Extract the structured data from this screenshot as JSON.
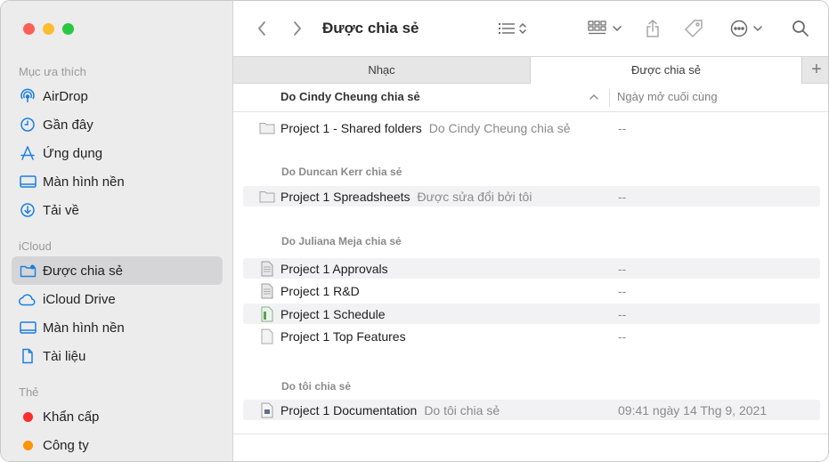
{
  "window": {
    "title": "Được chia sẻ"
  },
  "sidebar": {
    "sections": [
      {
        "heading": "Mục ưa thích",
        "items": [
          {
            "label": "AirDrop",
            "icon": "airdrop-icon"
          },
          {
            "label": "Gần đây",
            "icon": "clock-icon"
          },
          {
            "label": "Ứng dụng",
            "icon": "applications-icon"
          },
          {
            "label": "Màn hình nền",
            "icon": "desktop-icon"
          },
          {
            "label": "Tải về",
            "icon": "download-icon"
          }
        ]
      },
      {
        "heading": "iCloud",
        "items": [
          {
            "label": "Được chia sẻ",
            "icon": "shared-folder-icon",
            "active": true
          },
          {
            "label": "iCloud Drive",
            "icon": "cloud-icon"
          },
          {
            "label": "Màn hình nền",
            "icon": "desktop-icon"
          },
          {
            "label": "Tài liệu",
            "icon": "document-icon"
          }
        ]
      },
      {
        "heading": "Thẻ",
        "items": [
          {
            "label": "Khẩn cấp",
            "color": "#ff2d2d"
          },
          {
            "label": "Công ty",
            "color": "#ff9500"
          }
        ]
      }
    ],
    "accent": "#1a7fe0"
  },
  "tabs": [
    {
      "label": "Nhạc"
    },
    {
      "label": "Được chia sẻ"
    }
  ],
  "columns": {
    "name": "Do Cindy Cheung chia sẻ",
    "date": "Ngày mở cuối cùng"
  },
  "groups": [
    {
      "heading": "",
      "rows": [
        {
          "name": "Project 1 - Shared folders",
          "sub": "Do Cindy Cheung chia sẻ",
          "date": "--",
          "icon": "folder-icon"
        }
      ]
    },
    {
      "heading": "Do Duncan Kerr chia sẻ",
      "rows": [
        {
          "name": "Project 1 Spreadsheets",
          "sub": "Được sửa đổi bởi tôi",
          "date": "--",
          "icon": "folder-icon"
        }
      ]
    },
    {
      "heading": "Do Juliana Meja chia sẻ",
      "rows": [
        {
          "name": "Project 1 Approvals",
          "sub": "",
          "date": "--",
          "icon": "file-icon"
        },
        {
          "name": "Project 1 R&D",
          "sub": "",
          "date": "--",
          "icon": "file-icon"
        },
        {
          "name": "Project 1 Schedule",
          "sub": "",
          "date": "--",
          "icon": "spreadsheet-file-icon"
        },
        {
          "name": "Project 1 Top Features",
          "sub": "",
          "date": "--",
          "icon": "file-icon"
        }
      ]
    },
    {
      "heading": "Do tôi chia sẻ",
      "rows": [
        {
          "name": "Project 1 Documentation",
          "sub": "Do tôi chia sẻ",
          "date": "09:41 ngày 14 Thg 9, 2021",
          "icon": "pages-file-icon"
        }
      ]
    }
  ]
}
